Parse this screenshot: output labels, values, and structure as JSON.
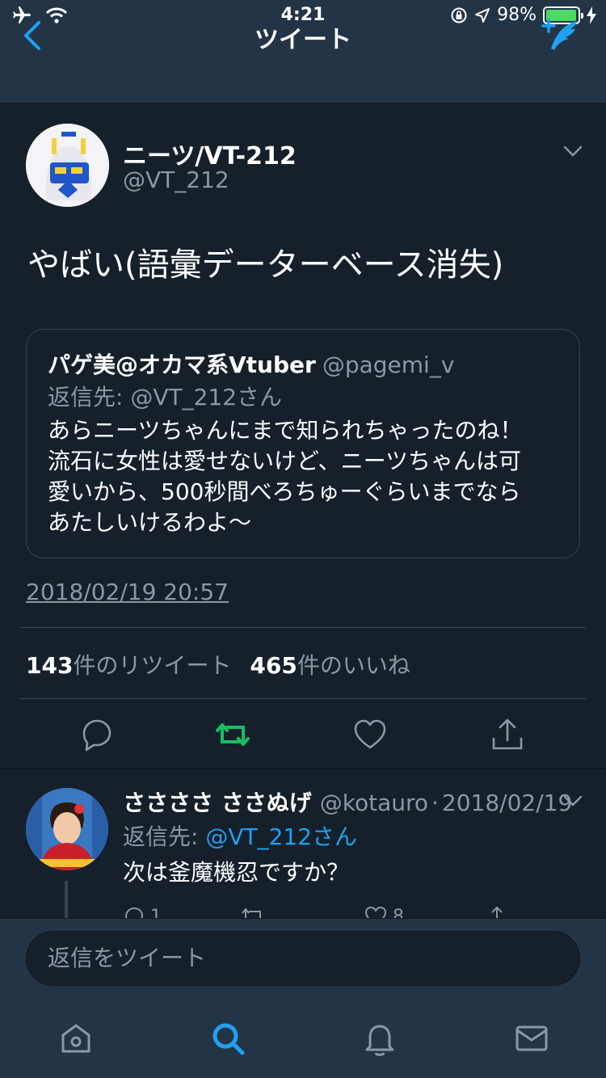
{
  "status_bar": {
    "time": "4:21",
    "battery": "98%",
    "battery_level": 0.98,
    "icons": [
      "airplane-icon",
      "wifi-icon",
      "orientation-lock-icon",
      "location-icon",
      "battery-icon",
      "charging-icon"
    ]
  },
  "nav": {
    "title": "ツイート",
    "back_icon": "back-chevron-icon",
    "compose_icon": "compose-icon"
  },
  "tweet": {
    "author_name": "ニーツ/VT-212",
    "author_handle": "@VT_212",
    "text": "やばい(語彙データーベース消失)",
    "timestamp": "2018/02/19 20:57",
    "quote": {
      "name": "パゲ美@オカマ系Vtuber",
      "handle": "@pagemi_v",
      "reply_to": "返信先: @VT_212さん",
      "lines": [
        "あらニーツちゃんにまで知られちゃったのね！",
        "流石に女性は愛せないけど、ニーツちゃんは可",
        "愛いから、500秒間べろちゅーぐらいまでなら",
        "あたしいけるわよ〜"
      ]
    },
    "stats": {
      "retweet_count": "143",
      "retweet_label": "件のリツイート",
      "like_count": "465",
      "like_label": "件のいいね"
    }
  },
  "reply": {
    "name": "ささささ ささぬげ",
    "handle": "@kotauro",
    "separator": "·",
    "date": "2018/02/19",
    "reply_to_prefix": "返信先: ",
    "reply_to_handle": "@VT_212さん",
    "text": "次は釜魔機忍ですか？",
    "reply_count": "1",
    "like_count": "8"
  },
  "compose": {
    "placeholder": "返信をツイート"
  },
  "tabs": [
    "home-icon",
    "search-icon",
    "notifications-icon",
    "messages-icon"
  ],
  "colors": {
    "background": "#15202b",
    "bar": "#243447",
    "accent": "#1da1f2",
    "retweet_active": "#17bf63",
    "muted": "#8899a6"
  }
}
